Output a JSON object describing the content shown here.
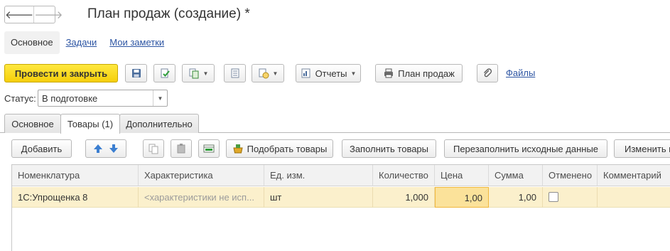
{
  "window": {
    "title": "План продаж (создание) *"
  },
  "nav": {
    "back_glyph": "🡐",
    "forward_glyph": "🡒"
  },
  "sections": [
    {
      "label": "Основное"
    },
    {
      "label": "Задачи"
    },
    {
      "label": "Мои заметки"
    }
  ],
  "toolbar": {
    "post_close_label": "Провести и закрыть",
    "reports_label": "Отчеты",
    "print_label": "План продаж",
    "files_label": "Файлы"
  },
  "status": {
    "label": "Статус:",
    "value": "В подготовке"
  },
  "form_tabs": [
    {
      "label": "Основное"
    },
    {
      "label": "Товары (1)"
    },
    {
      "label": "Дополнительно"
    }
  ],
  "goods_toolbar": {
    "add_label": "Добавить",
    "pick_label": "Подобрать товары",
    "fill_label": "Заполнить товары",
    "refill_label": "Перезаполнить исходные данные",
    "change_label": "Изменить к"
  },
  "table": {
    "columns": [
      "Номенклатура",
      "Характеристика",
      "Ед. изм.",
      "Количество",
      "Цена",
      "Сумма",
      "Отменено",
      "Комментарий"
    ],
    "rows": [
      {
        "nomenclature": "1С:Упрощенка 8",
        "characteristic": "<характеристики не исп...",
        "unit": "шт",
        "quantity": "1,000",
        "price": "1,00",
        "sum": "1,00",
        "cancelled": false,
        "comment": ""
      }
    ]
  },
  "colors": {
    "primary_button": "#f5cf0a",
    "link": "#2d55a3",
    "row_highlight": "#fbf0cc"
  }
}
